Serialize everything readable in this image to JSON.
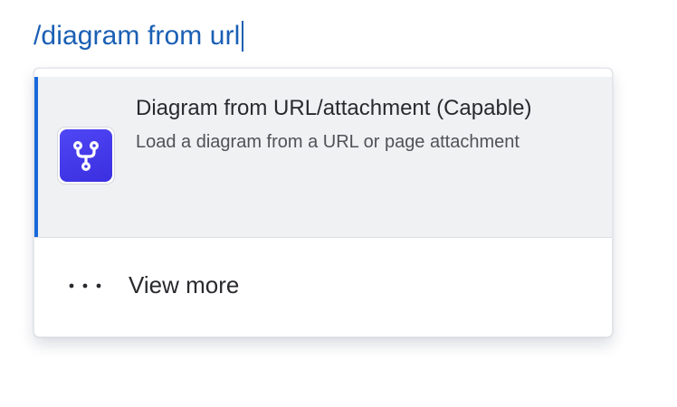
{
  "editor": {
    "typed_text": "/diagram from url"
  },
  "dropdown": {
    "items": [
      {
        "title": "Diagram from URL/attachment (Capable)",
        "description": "Load a diagram from a URL or page attachment",
        "icon": "branch-icon",
        "selected": true
      }
    ],
    "view_more_label": "View more",
    "view_more_icon": "more-horizontal-icon"
  },
  "colors": {
    "typed_text": "#1a5fb4",
    "selected_accent": "#1868db",
    "selected_background": "#f0f1f3",
    "app_icon_background": "#4f46f5"
  }
}
